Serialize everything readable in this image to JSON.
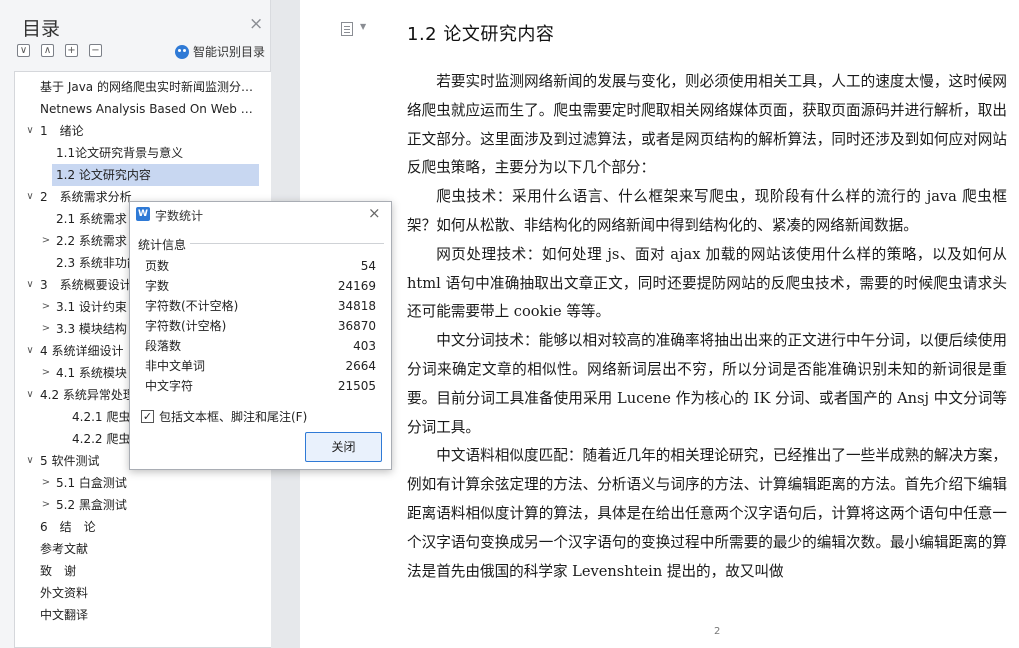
{
  "nav": {
    "title": "目录",
    "smart_label": "智能识别目录",
    "items": [
      {
        "label": "基于 Java 的网络爬虫实时新闻监测分 ...",
        "caret": "",
        "level": 0
      },
      {
        "label": "Netnews Analysis Based On Web S ...",
        "caret": "",
        "level": 0
      },
      {
        "label": "1　绪论",
        "caret": "∨",
        "level": 0
      },
      {
        "label": "1.1论文研究背景与意义",
        "caret": "",
        "level": 1
      },
      {
        "label": "1.2  论文研究内容",
        "caret": "",
        "level": 1,
        "active": true
      },
      {
        "label": "2　系统需求分析",
        "caret": "∨",
        "level": 0
      },
      {
        "label": "2.1  系统需求",
        "caret": "",
        "level": 1
      },
      {
        "label": "2.2  系统需求",
        "caret": ">",
        "level": 1
      },
      {
        "label": "2.3  系统非功能",
        "caret": "",
        "level": 1
      },
      {
        "label": "3　系统概要设计",
        "caret": "∨",
        "level": 0
      },
      {
        "label": "3.1  设计约束",
        "caret": ">",
        "level": 1
      },
      {
        "label": "3.3  模块结构",
        "caret": ">",
        "level": 1
      },
      {
        "label": "4  系统详细设计",
        "caret": "∨",
        "level": 0
      },
      {
        "label": "4.1  系统模块",
        "caret": ">",
        "level": 1
      },
      {
        "label": "4.2  系统异常处理",
        "caret": "∨",
        "level": 0
      },
      {
        "label": "4.2.1  爬虫",
        "caret": "",
        "level": 2
      },
      {
        "label": "4.2.2  爬虫",
        "caret": "",
        "level": 2
      },
      {
        "label": "5  软件测试",
        "caret": "∨",
        "level": 0
      },
      {
        "label": "5.1  白盒测试",
        "caret": ">",
        "level": 1
      },
      {
        "label": "5.2  黑盒测试",
        "caret": ">",
        "level": 1
      },
      {
        "label": "6　结　论",
        "caret": "",
        "level": 0
      },
      {
        "label": "参考文献",
        "caret": "",
        "level": -1
      },
      {
        "label": "致　谢",
        "caret": "",
        "level": 0
      },
      {
        "label": "外文资料",
        "caret": "",
        "level": 0
      },
      {
        "label": "中文翻译",
        "caret": "",
        "level": 0
      }
    ]
  },
  "doc": {
    "heading": "1.2  论文研究内容",
    "paragraphs": [
      "若要实时监测网络新闻的发展与变化，则必须使用相关工具，人工的速度太慢，这时候网络爬虫就应运而生了。爬虫需要定时爬取相关网络媒体页面，获取页面源码并进行解析，取出正文部分。这里面涉及到过滤算法，或者是网页结构的解析算法，同时还涉及到如何应对网站反爬虫策略，主要分为以下几个部分：",
      "爬虫技术：采用什么语言、什么框架来写爬虫，现阶段有什么样的流行的 java 爬虫框架？如何从松散、非结构化的网络新闻中得到结构化的、紧凑的网络新闻数据。",
      "网页处理技术：如何处理 js、面对 ajax 加载的网站该使用什么样的策略，以及如何从 html 语句中准确抽取出文章正文，同时还要提防网站的反爬虫技术，需要的时候爬虫请求头还可能需要带上 cookie 等等。",
      "中文分词技术：能够以相对较高的准确率将抽出出来的正文进行中午分词，以便后续使用分词来确定文章的相似性。网络新词层出不穷，所以分词是否能准确识别未知的新词很是重要。目前分词工具准备使用采用 Lucene 作为核心的 IK 分词、或者国产的 Ansj 中文分词等分词工具。",
      "中文语料相似度匹配：随着近几年的相关理论研究，已经推出了一些半成熟的解决方案，例如有计算余弦定理的方法、分析语义与词序的方法、计算编辑距离的方法。首先介绍下编辑距离语料相似度计算的算法，具体是在给出任意两个汉字语句后，计算将这两个语句中任意一个汉字语句变换成另一个汉字语句的变换过程中所需要的最少的编辑次数。最小编辑距离的算法是首先由俄国的科学家 Levenshtein 提出的，故又叫做"
    ],
    "page_number": "2"
  },
  "dialog": {
    "logo": "W",
    "title": "字数统计",
    "section": "统计信息",
    "stats": [
      {
        "label": "页数",
        "value": "54"
      },
      {
        "label": "字数",
        "value": "24169"
      },
      {
        "label": "字符数(不计空格)",
        "value": "34818"
      },
      {
        "label": "字符数(计空格)",
        "value": "36870"
      },
      {
        "label": "段落数",
        "value": "403"
      },
      {
        "label": "非中文单词",
        "value": "2664"
      },
      {
        "label": "中文字符",
        "value": "21505"
      }
    ],
    "checkbox_label": "包括文本框、脚注和尾注(F)",
    "checkbox_checked": true,
    "close_button": "关闭"
  },
  "colors": {
    "accent": "#2f7ad6",
    "active_row": "#c8d7f1"
  }
}
